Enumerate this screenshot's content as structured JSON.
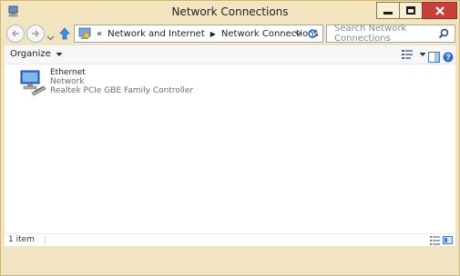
{
  "window": {
    "title": "Network Connections"
  },
  "address": {
    "root_marker": "«",
    "crumbs": [
      "Network and Internet",
      "Network Connections"
    ]
  },
  "search": {
    "placeholder": "Search Network Connections"
  },
  "toolbar": {
    "organize_label": "Organize"
  },
  "items": [
    {
      "name": "Ethernet",
      "status": "Network",
      "device": "Realtek PCIe GBE Family Controller"
    }
  ],
  "status_bar": {
    "count_text": "1 item"
  },
  "icons": {
    "app": "network-connections-icon",
    "back": "back-arrow-icon",
    "forward": "forward-arrow-icon",
    "recent": "chevron-down-icon",
    "up": "up-arrow-icon",
    "address_icon": "control-panel-icon",
    "dropdown": "chevron-down-icon",
    "refresh": "refresh-icon",
    "search": "search-icon",
    "view_options": "view-options-icon",
    "preview_pane": "preview-pane-icon",
    "help": "help-icon",
    "adapter": "ethernet-adapter-icon",
    "details_view": "details-view-icon",
    "large_icons_view": "large-icons-view-icon"
  },
  "colors": {
    "frame": "#f0e4c2",
    "close_button": "#c7403a",
    "link_blue": "#1f5fa8"
  }
}
